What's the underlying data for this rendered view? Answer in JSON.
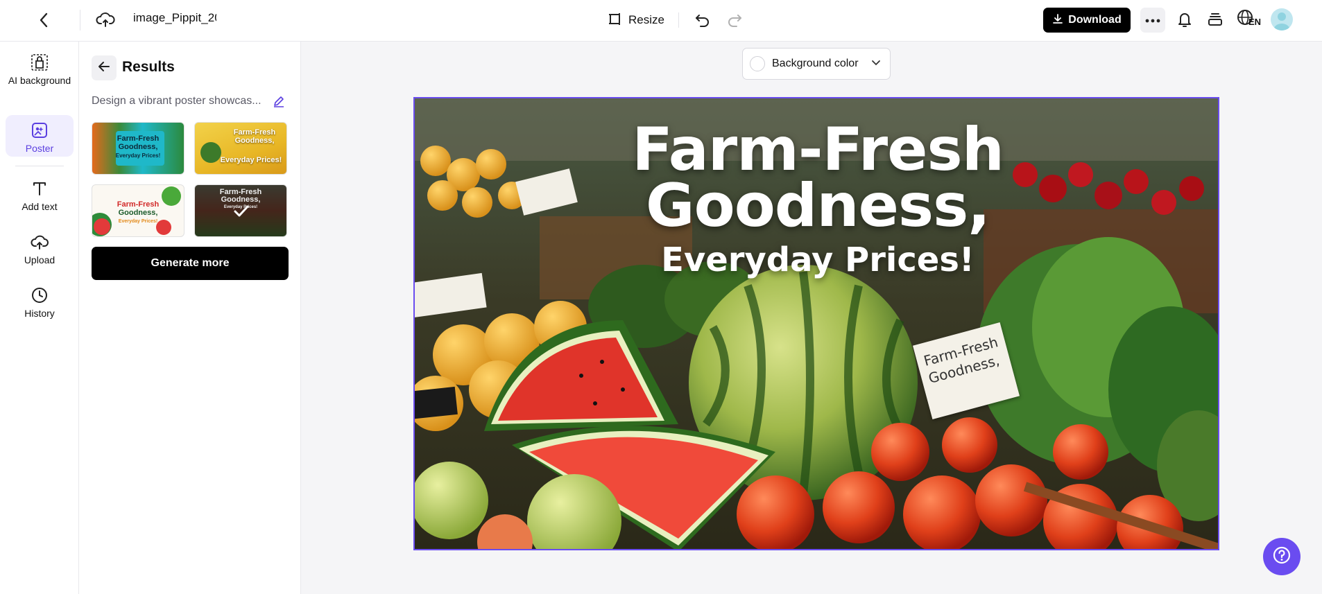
{
  "topbar": {
    "filename": "image_Pippit_20",
    "resize_label": "Resize",
    "download_label": "Download",
    "lang_label": "EN"
  },
  "rail": {
    "items": [
      {
        "label": "AI background",
        "icon": "ai-background-icon"
      },
      {
        "label": "Poster",
        "icon": "poster-icon",
        "active": true
      },
      {
        "label": "Add text",
        "icon": "text-icon"
      },
      {
        "label": "Upload",
        "icon": "upload-icon"
      },
      {
        "label": "History",
        "icon": "clock-icon"
      }
    ]
  },
  "panel": {
    "title": "Results",
    "prompt": "Design a vibrant poster showcas...",
    "thumbnails": [
      {
        "line1": "Farm-Fresh",
        "line2": "Goodness,",
        "line3": "Everyday Prices!"
      },
      {
        "line1": "Farm-Fresh",
        "line2": "Goodness,",
        "line3": "Everyday Prices!"
      },
      {
        "line1": "Farm-Fresh",
        "line2": "Goodness,",
        "line3": "Everyday Prices!"
      },
      {
        "line1": "Farm-Fresh",
        "line2": "Goodness,",
        "line3": "Everyday Prices!",
        "selected": true
      }
    ],
    "generate_label": "Generate more"
  },
  "canvas": {
    "bg_color_label": "Background color",
    "poster": {
      "title_line1": "Farm-Fresh",
      "title_line2": "Goodness,",
      "subtitle": "Everyday Prices!",
      "sign_line1": "Farm-Fresh",
      "sign_line2": "Goodness,"
    }
  },
  "colors": {
    "accent": "#6a4cf0",
    "button_dark": "#000000"
  }
}
